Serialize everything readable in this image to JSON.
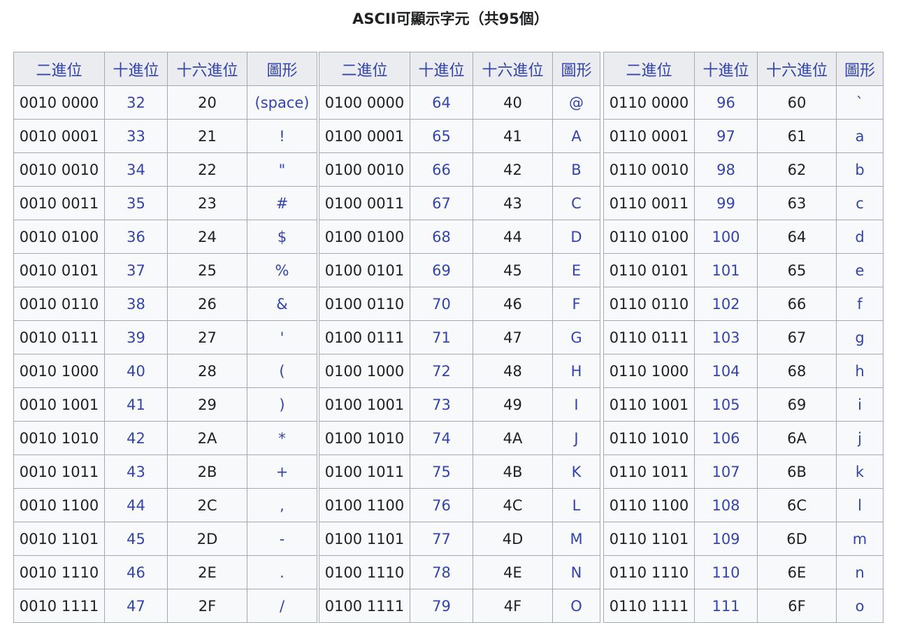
{
  "caption": "ASCII可顯示字元（共95個）",
  "headers": [
    "二進位",
    "十進位",
    "十六進位",
    "圖形"
  ],
  "tables": [
    {
      "rows": [
        [
          "0010 0000",
          "32",
          "20",
          "(space)"
        ],
        [
          "0010 0001",
          "33",
          "21",
          "!"
        ],
        [
          "0010 0010",
          "34",
          "22",
          "\""
        ],
        [
          "0010 0011",
          "35",
          "23",
          "#"
        ],
        [
          "0010 0100",
          "36",
          "24",
          "$"
        ],
        [
          "0010 0101",
          "37",
          "25",
          "%"
        ],
        [
          "0010 0110",
          "38",
          "26",
          "&"
        ],
        [
          "0010 0111",
          "39",
          "27",
          "'"
        ],
        [
          "0010 1000",
          "40",
          "28",
          "("
        ],
        [
          "0010 1001",
          "41",
          "29",
          ")"
        ],
        [
          "0010 1010",
          "42",
          "2A",
          "*"
        ],
        [
          "0010 1011",
          "43",
          "2B",
          "+"
        ],
        [
          "0010 1100",
          "44",
          "2C",
          ","
        ],
        [
          "0010 1101",
          "45",
          "2D",
          "-"
        ],
        [
          "0010 1110",
          "46",
          "2E",
          "."
        ],
        [
          "0010 1111",
          "47",
          "2F",
          "/"
        ]
      ]
    },
    {
      "rows": [
        [
          "0100 0000",
          "64",
          "40",
          "@"
        ],
        [
          "0100 0001",
          "65",
          "41",
          "A"
        ],
        [
          "0100 0010",
          "66",
          "42",
          "B"
        ],
        [
          "0100 0011",
          "67",
          "43",
          "C"
        ],
        [
          "0100 0100",
          "68",
          "44",
          "D"
        ],
        [
          "0100 0101",
          "69",
          "45",
          "E"
        ],
        [
          "0100 0110",
          "70",
          "46",
          "F"
        ],
        [
          "0100 0111",
          "71",
          "47",
          "G"
        ],
        [
          "0100 1000",
          "72",
          "48",
          "H"
        ],
        [
          "0100 1001",
          "73",
          "49",
          "I"
        ],
        [
          "0100 1010",
          "74",
          "4A",
          "J"
        ],
        [
          "0100 1011",
          "75",
          "4B",
          "K"
        ],
        [
          "0100 1100",
          "76",
          "4C",
          "L"
        ],
        [
          "0100 1101",
          "77",
          "4D",
          "M"
        ],
        [
          "0100 1110",
          "78",
          "4E",
          "N"
        ],
        [
          "0100 1111",
          "79",
          "4F",
          "O"
        ]
      ]
    },
    {
      "rows": [
        [
          "0110 0000",
          "96",
          "60",
          "`"
        ],
        [
          "0110 0001",
          "97",
          "61",
          "a"
        ],
        [
          "0110 0010",
          "98",
          "62",
          "b"
        ],
        [
          "0110 0011",
          "99",
          "63",
          "c"
        ],
        [
          "0110 0100",
          "100",
          "64",
          "d"
        ],
        [
          "0110 0101",
          "101",
          "65",
          "e"
        ],
        [
          "0110 0110",
          "102",
          "66",
          "f"
        ],
        [
          "0110 0111",
          "103",
          "67",
          "g"
        ],
        [
          "0110 1000",
          "104",
          "68",
          "h"
        ],
        [
          "0110 1001",
          "105",
          "69",
          "i"
        ],
        [
          "0110 1010",
          "106",
          "6A",
          "j"
        ],
        [
          "0110 1011",
          "107",
          "6B",
          "k"
        ],
        [
          "0110 1100",
          "108",
          "6C",
          "l"
        ],
        [
          "0110 1101",
          "109",
          "6D",
          "m"
        ],
        [
          "0110 1110",
          "110",
          "6E",
          "n"
        ],
        [
          "0110 1111",
          "111",
          "6F",
          "o"
        ]
      ]
    }
  ]
}
